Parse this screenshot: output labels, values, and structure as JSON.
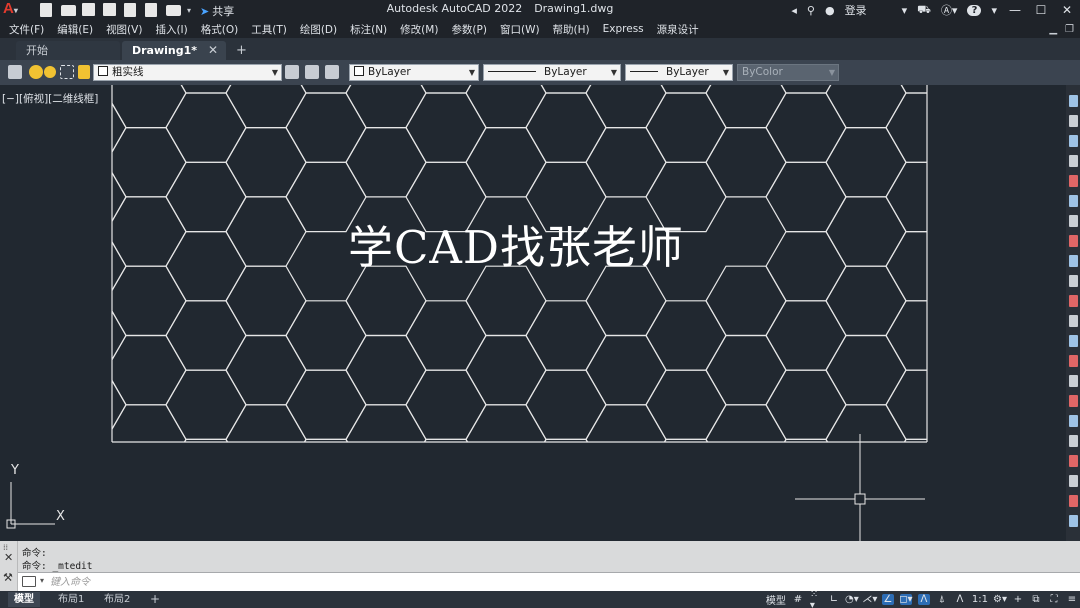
{
  "window": {
    "title_app": "Autodesk AutoCAD 2022",
    "title_file": "Drawing1.dwg",
    "share_label": "共享",
    "login_label": "登录",
    "help_label": "?"
  },
  "menu": [
    "文件(F)",
    "编辑(E)",
    "视图(V)",
    "插入(I)",
    "格式(O)",
    "工具(T)",
    "绘图(D)",
    "标注(N)",
    "修改(M)",
    "参数(P)",
    "窗口(W)",
    "帮助(H)",
    "Express",
    "源泉设计"
  ],
  "tabs": {
    "start": "开始",
    "drawing": "Drawing1*",
    "close": "✕",
    "add": "+"
  },
  "properties": {
    "layer": "粗实线",
    "color": "ByLayer",
    "linetype": "ByLayer",
    "lineweight": "ByLayer",
    "plotstyle": "ByColor"
  },
  "canvas": {
    "viewport_label": "[−][俯视][二维线框]",
    "overlay_text": "学CAD找张老师",
    "ucs_x": "X",
    "ucs_y": "Y"
  },
  "command": {
    "history": [
      "命令:",
      "命令: _mtedit"
    ],
    "placeholder": "键入命令"
  },
  "status": {
    "tabs": [
      "模型",
      "布局1",
      "布局2"
    ],
    "add": "+",
    "model_label": "模型",
    "scale": "1:1"
  },
  "colors": {
    "accent": "#2d6db5",
    "canvas": "#212830",
    "lines": "#e6e6e6"
  }
}
